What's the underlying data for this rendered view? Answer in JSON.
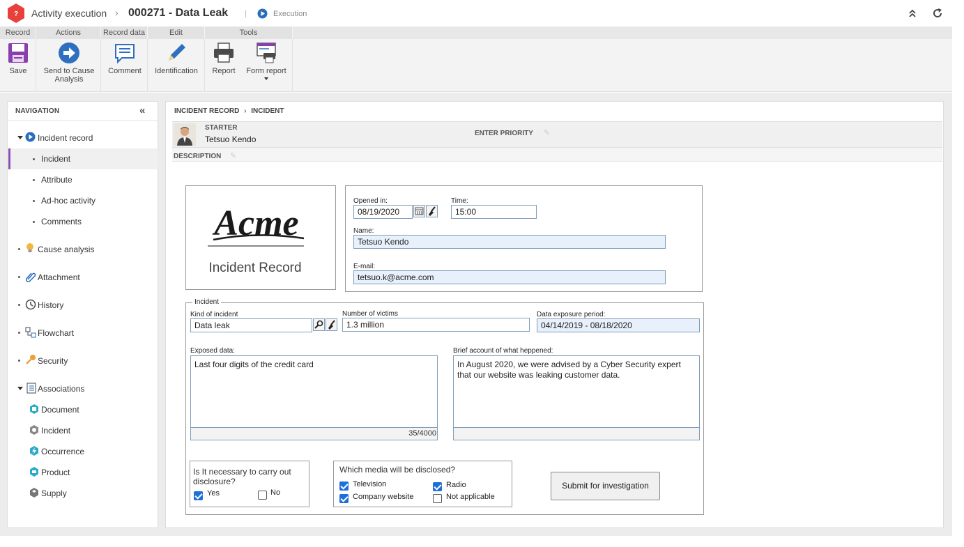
{
  "header": {
    "breadcrumb_app": "Activity execution",
    "record_title": "000271 - Data Leak",
    "status": "Execution"
  },
  "ribbon": {
    "groups": [
      "Record",
      "Actions",
      "Record data",
      "Edit",
      "Tools"
    ],
    "buttons": {
      "save": "Save",
      "send_line1": "Send to Cause",
      "send_line2": "Analysis",
      "comment": "Comment",
      "identification": "Identification",
      "report": "Report",
      "form_report": "Form report"
    }
  },
  "navigation": {
    "title": "NAVIGATION",
    "items": {
      "incident_record": "Incident record",
      "incident": "Incident",
      "attribute": "Attribute",
      "adhoc": "Ad-hoc activity",
      "comments": "Comments",
      "cause_analysis": "Cause analysis",
      "attachment": "Attachment",
      "history": "History",
      "flowchart": "Flowchart",
      "security": "Security",
      "associations": "Associations",
      "document": "Document",
      "incident_assoc": "Incident",
      "occurrence": "Occurrence",
      "product": "Product",
      "supply": "Supply"
    }
  },
  "content": {
    "crumb_1": "INCIDENT RECORD",
    "crumb_2": "INCIDENT",
    "starter_label": "STARTER",
    "starter_name": "Tetsuo Kendo",
    "priority_label": "ENTER PRIORITY",
    "description_label": "DESCRIPTION"
  },
  "form": {
    "logo_text": "Acme",
    "logo_caption": "Incident Record",
    "opened_label": "Opened in:",
    "opened_value": "08/19/2020",
    "time_label": "Time:",
    "time_value": "15:00",
    "name_label": "Name:",
    "name_value": "Tetsuo Kendo",
    "email_label": "E-mail:",
    "email_value": "tetsuo.k@acme.com",
    "incident_legend": "Incident",
    "kind_label": "Kind of incident",
    "kind_value": "Data leak",
    "victims_label": "Number of victims",
    "victims_value": "1.3 million",
    "period_label": "Data exposure period:",
    "period_value": "04/14/2019 - 08/18/2020",
    "exposed_label": "Exposed data:",
    "exposed_value": "Last four digits of the credit card",
    "exposed_count": "35/4000",
    "account_label": "Brief account of what heppened:",
    "account_value": "In August 2020, we were advised by a Cyber Security expert that our website was leaking customer data.",
    "disclosure_question": "Is It necessary to carry out disclosure?",
    "yes_label": "Yes",
    "no_label": "No",
    "media_question": "Which media will be disclosed?",
    "media": {
      "television": "Television",
      "radio": "Radio",
      "website": "Company website",
      "not_applicable": "Not applicable"
    },
    "submit_label": "Submit for investigation"
  },
  "colors": {
    "accent_red": "#e8413c",
    "execution_blue": "#2a6ebb",
    "active_nav": "#8a4fb0",
    "check_blue": "#1e6fd9"
  }
}
